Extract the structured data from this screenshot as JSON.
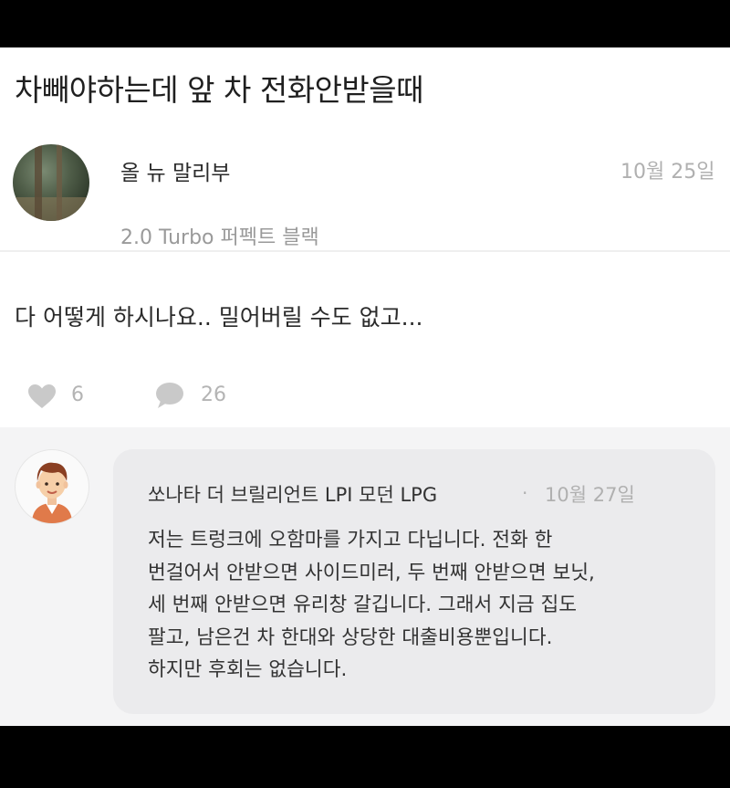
{
  "post": {
    "title": "차빼야하는데 앞 차 전화안받을때",
    "author": {
      "name": "올 뉴 말리부",
      "car": "2.0 Turbo 퍼펙트 블랙"
    },
    "date": "10월 25일",
    "body": "다 어떻게 하시나요.. 밀어버릴 수도 없고...",
    "likes": "6",
    "comments": "26"
  },
  "comment": {
    "author": "쏘나타 더 브릴리언트 LPI 모던 LPG",
    "separator": "·",
    "date": "10월 27일",
    "lines": [
      "저는 트렁크에 오함마를 가지고 다닙니다. 전화 한",
      "번걸어서 안받으면 사이드미러, 두 번째 안받으면 보닛,",
      "세 번째 안받으면 유리창 갈깁니다. 그래서 지금 집도",
      "팔고, 남은건 차 한대와 상당한 대출비용뿐입니다.",
      "하지만 후회는 없습니다."
    ]
  },
  "icons": {
    "like": "heart-icon",
    "comment": "speech-bubble-icon"
  },
  "colors": {
    "background": "#ffffff",
    "muted_text": "#b0b0b0",
    "comment_bg": "#ebebed",
    "comments_area_bg": "#f4f4f5"
  }
}
